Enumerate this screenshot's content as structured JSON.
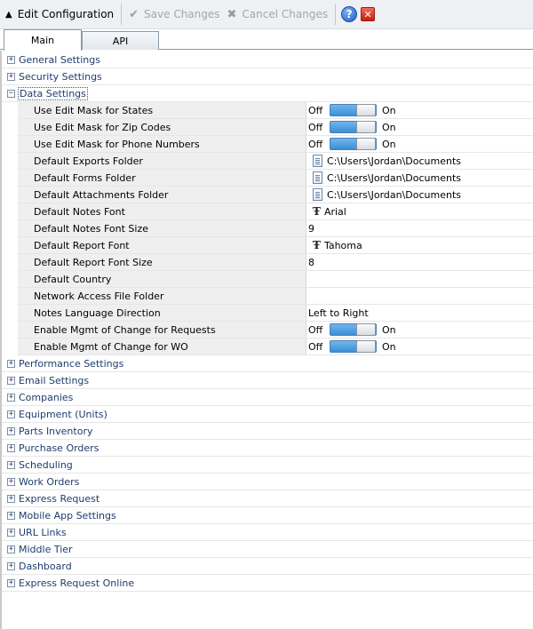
{
  "toolbar": {
    "title": "Edit Configuration",
    "save_label": "Save Changes",
    "cancel_label": "Cancel Changes"
  },
  "tabs": [
    {
      "label": "Main"
    },
    {
      "label": "API"
    }
  ],
  "categories_before": [
    {
      "label": "General Settings"
    },
    {
      "label": "Security Settings"
    }
  ],
  "expanded_category": {
    "label": "Data Settings"
  },
  "properties": [
    {
      "name": "Use Edit Mask for States",
      "off": "Off",
      "on": "On"
    },
    {
      "name": "Use Edit Mask for Zip Codes",
      "off": "Off",
      "on": "On"
    },
    {
      "name": "Use Edit Mask for Phone Numbers",
      "off": "Off",
      "on": "On"
    },
    {
      "name": "Default Exports Folder",
      "value": "C:\\Users\\Jordan\\Documents"
    },
    {
      "name": "Default Forms Folder",
      "value": "C:\\Users\\Jordan\\Documents"
    },
    {
      "name": "Default Attachments Folder",
      "value": "C:\\Users\\Jordan\\Documents"
    },
    {
      "name": "Default Notes Font",
      "value": "Arial"
    },
    {
      "name": "Default Notes Font Size",
      "value": "9"
    },
    {
      "name": "Default Report Font",
      "value": "Tahoma"
    },
    {
      "name": "Default Report Font Size",
      "value": "8"
    },
    {
      "name": "Default Country",
      "value": ""
    },
    {
      "name": "Network Access File Folder",
      "value": ""
    },
    {
      "name": "Notes Language Direction",
      "value": "Left to Right"
    },
    {
      "name": "Enable Mgmt of Change for Requests",
      "off": "Off",
      "on": "On"
    },
    {
      "name": "Enable Mgmt of Change for WO",
      "off": "Off",
      "on": "On"
    }
  ],
  "categories_after": [
    {
      "label": "Performance Settings"
    },
    {
      "label": "Email Settings"
    },
    {
      "label": "Companies"
    },
    {
      "label": "Equipment (Units)"
    },
    {
      "label": "Parts Inventory"
    },
    {
      "label": "Purchase Orders"
    },
    {
      "label": "Scheduling"
    },
    {
      "label": "Work Orders"
    },
    {
      "label": "Express Request"
    },
    {
      "label": "Mobile App Settings"
    },
    {
      "label": "URL Links"
    },
    {
      "label": "Middle Tier"
    },
    {
      "label": "Dashboard"
    },
    {
      "label": "Express Request Online"
    }
  ]
}
